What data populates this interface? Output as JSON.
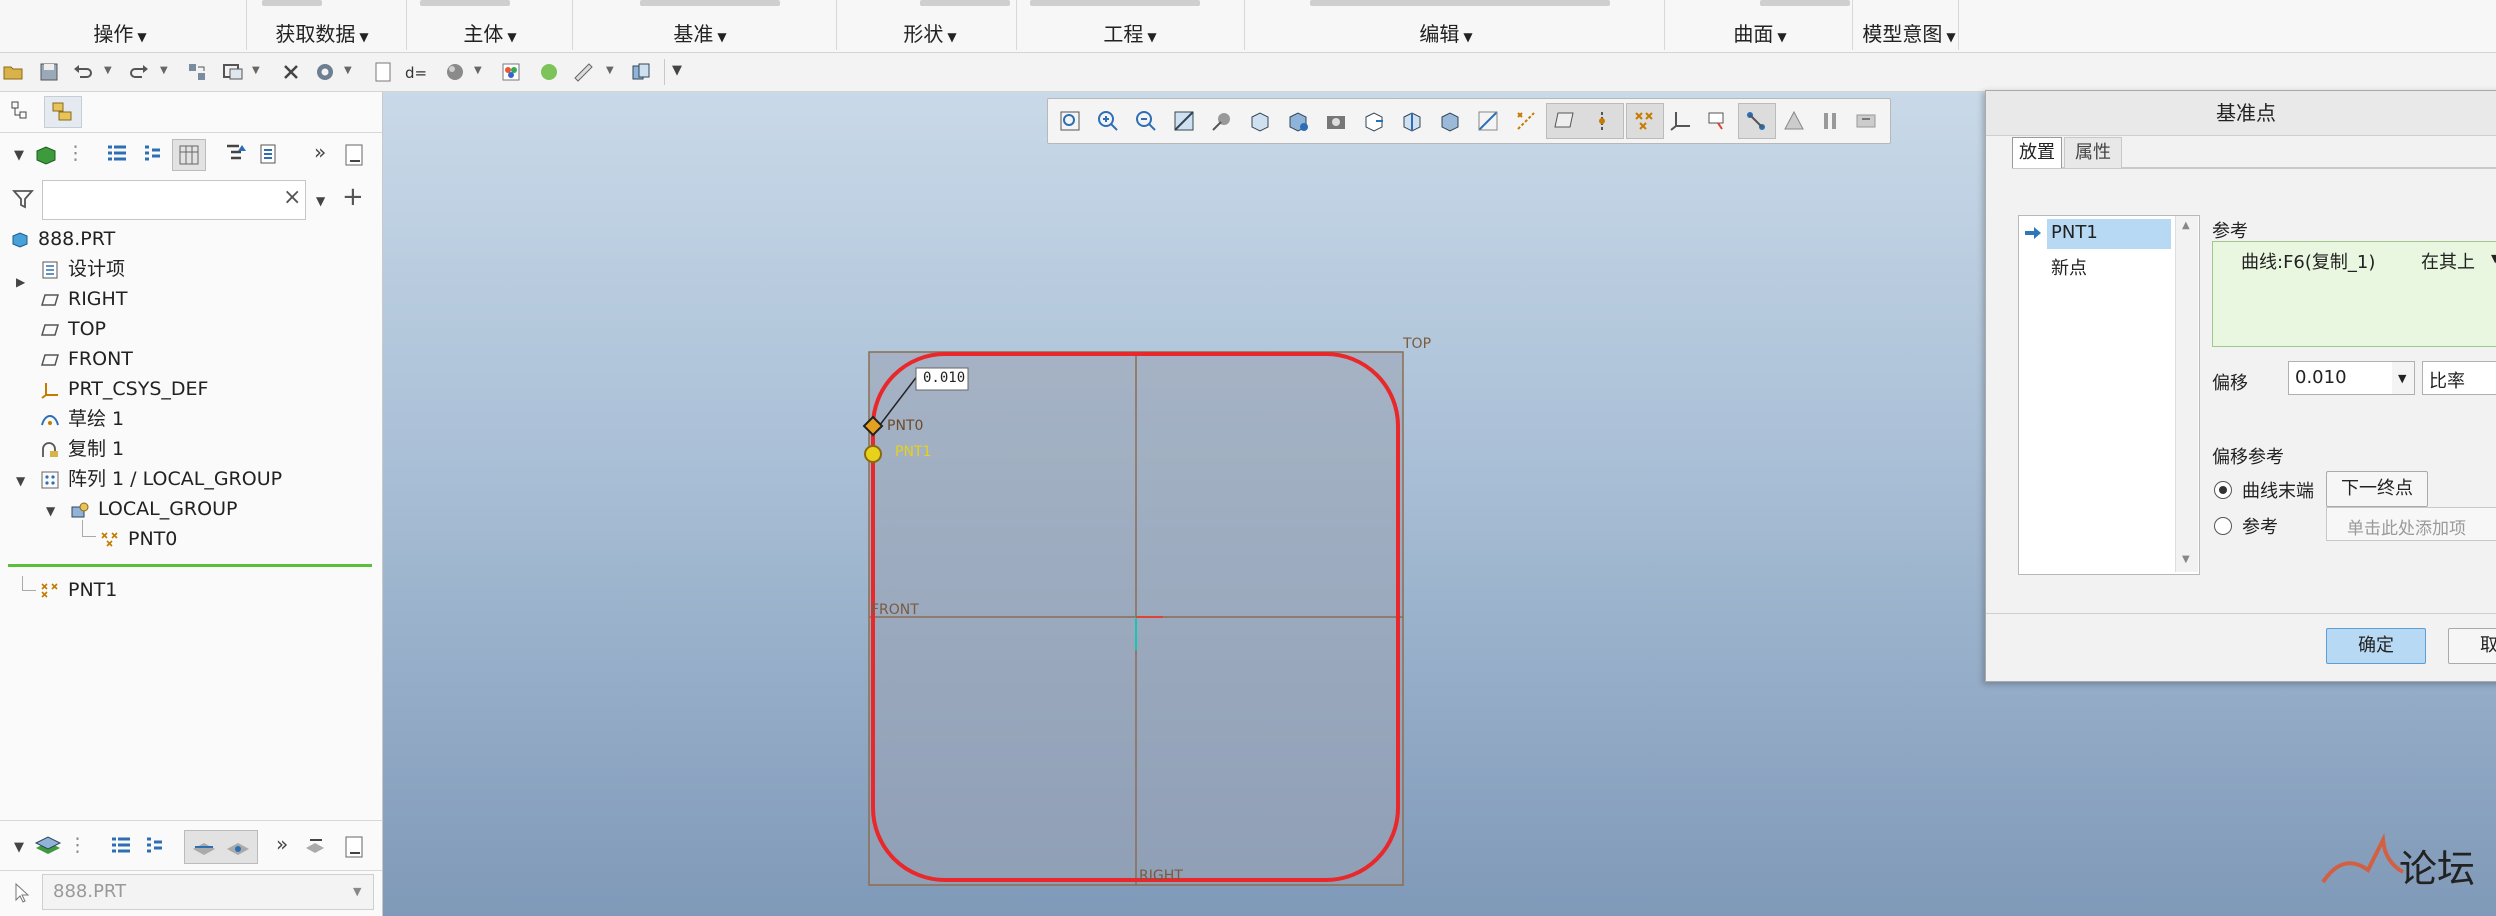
{
  "ribbon": {
    "groups": [
      {
        "label": "操作"
      },
      {
        "label": "获取数据"
      },
      {
        "label": "主体"
      },
      {
        "label": "基准"
      },
      {
        "label": "形状"
      },
      {
        "label": "工程"
      },
      {
        "label": "编辑"
      },
      {
        "label": "曲面"
      },
      {
        "label": "模型意图"
      }
    ]
  },
  "model_tree": {
    "filter_placeholder": "",
    "items": [
      {
        "label": "888.PRT"
      },
      {
        "label": "设计项"
      },
      {
        "label": "RIGHT"
      },
      {
        "label": "TOP"
      },
      {
        "label": "FRONT"
      },
      {
        "label": "PRT_CSYS_DEF"
      },
      {
        "label": "草绘 1"
      },
      {
        "label": "复制 1"
      },
      {
        "label": "阵列 1 / LOCAL_GROUP"
      },
      {
        "label": "LOCAL_GROUP"
      },
      {
        "label": "PNT0"
      },
      {
        "label": "PNT1"
      }
    ]
  },
  "layer_panel": {
    "model_select": "888.PRT"
  },
  "viewport": {
    "plane_labels": {
      "top": "TOP",
      "front": "FRONT",
      "right": "RIGHT"
    },
    "dimension": "0.010",
    "point_labels": {
      "pnt0": "PNT0",
      "pnt1": "PNT1"
    },
    "colors": {
      "curve": "#e8282a",
      "selected_point": "#e6d21a",
      "background_top": "#c9d9e8",
      "background_bottom": "#7f99b8"
    }
  },
  "dialog": {
    "title": "基准点",
    "tabs": [
      {
        "label": "放置"
      },
      {
        "label": "属性"
      }
    ],
    "points_list": [
      {
        "label": "PNT1"
      },
      {
        "label": "新点"
      }
    ],
    "reference_heading": "参考",
    "reference_item": "曲线:F6(复制_1)",
    "reference_constraint": "在其上",
    "offset_label": "偏移",
    "offset_value": "0.010",
    "offset_type": "比率",
    "offset_ref_heading": "偏移参考",
    "radio_curve_end": "曲线末端",
    "next_end_button": "下一终点",
    "radio_reference": "参考",
    "reference_placeholder": "单击此处添加项",
    "ok_button": "确定",
    "cancel_button": "取消"
  },
  "watermark": {
    "text": "论坛"
  }
}
